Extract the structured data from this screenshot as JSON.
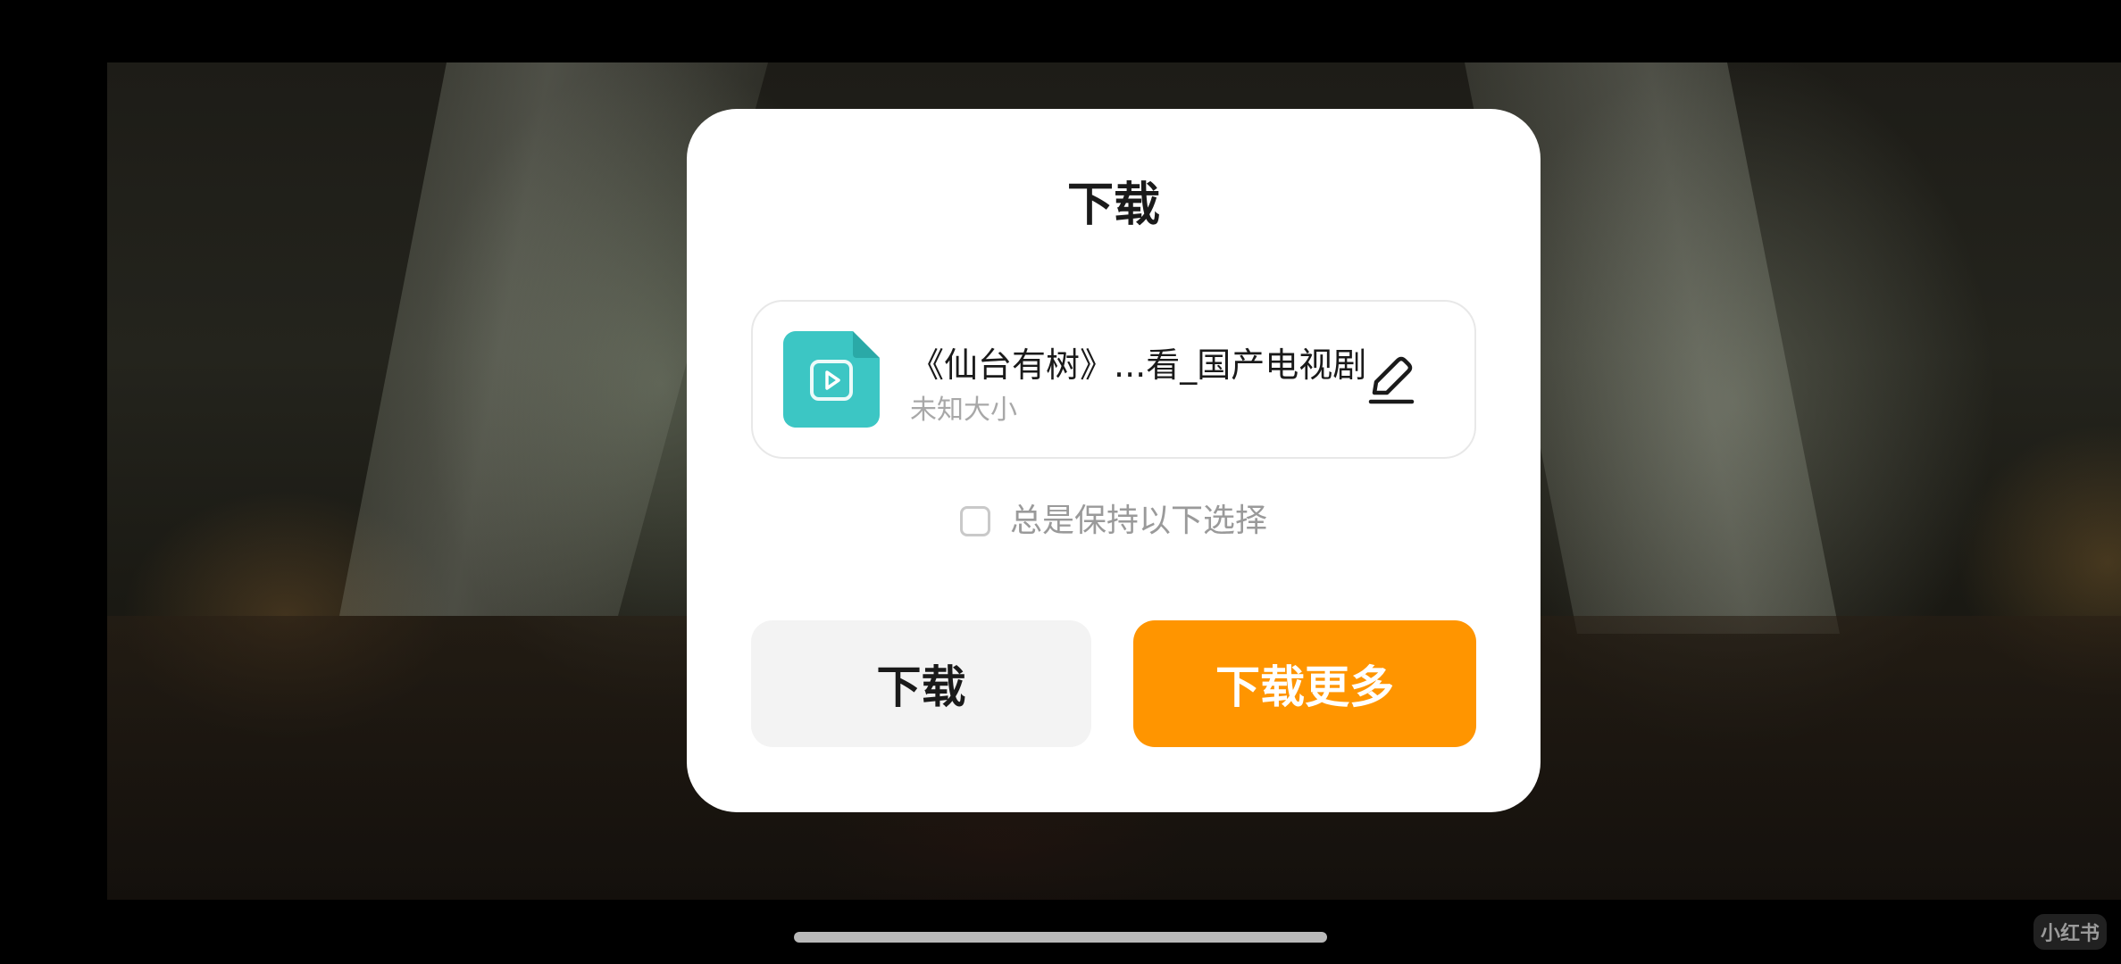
{
  "dialog": {
    "title": "下载",
    "file": {
      "name": "《仙台有树》...看_国产电视剧",
      "size": "未知大小",
      "icon": "video-file-icon",
      "icon_color": "#3cc6c4"
    },
    "always_keep_label": "总是保持以下选择",
    "always_keep_checked": false,
    "buttons": {
      "download": "下载",
      "download_more": "下载更多"
    },
    "accent_color": "#ff9500"
  },
  "watermark": "小红书"
}
